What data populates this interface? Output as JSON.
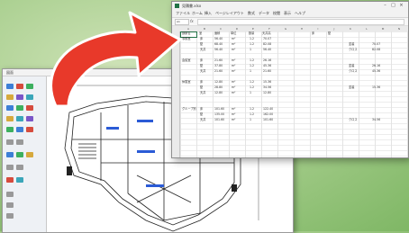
{
  "cad": {
    "title": "図面",
    "tool_colors": [
      "#3d7fd6",
      "#d64b3d",
      "#3db05f",
      "#d6a93d",
      "#7a56c8",
      "#3aa6b9"
    ]
  },
  "excel": {
    "document_title": "見積書.xlsx",
    "menu": [
      "ファイル",
      "ホーム",
      "挿入",
      "ページレイアウト",
      "数式",
      "データ",
      "校閲",
      "表示",
      "ヘルプ"
    ],
    "name_box": "A1",
    "fx_label": "fx",
    "columns": [
      "A",
      "B",
      "C",
      "D",
      "E",
      "F",
      "G",
      "H",
      "I",
      "J",
      "K",
      "L",
      "M",
      "N"
    ],
    "header_row": [
      "部屋名",
      "室",
      "面積",
      "単位",
      "数量",
      "天井高",
      "床",
      "壁",
      "天井"
    ],
    "rows": [
      [
        "事務室",
        "床",
        "56.40",
        "m²",
        "1.2",
        "70.07"
      ],
      [
        "",
        "壁",
        "68.40",
        "m²",
        "1.2",
        "82.08"
      ],
      [
        "",
        "天井",
        "56.40",
        "m²",
        "1",
        "56.40"
      ],
      [
        "会議室",
        "床",
        "21.60",
        "m²",
        "1.2",
        "26.16"
      ],
      [
        "",
        "壁",
        "37.80",
        "m²",
        "1.2",
        "45.36"
      ],
      [
        "",
        "天井",
        "21.60",
        "m²",
        "1",
        "21.60"
      ],
      [
        "休憩室",
        "床",
        "12.80",
        "m²",
        "1.2",
        "15.36"
      ],
      [
        "",
        "壁",
        "28.80",
        "m²",
        "1.2",
        "34.56"
      ],
      [
        "",
        "天井",
        "12.80",
        "m²",
        "1",
        "12.80"
      ],
      [
        "グループ別",
        "床",
        "101.60",
        "m²",
        "1.2",
        "122.40"
      ],
      [
        "",
        "壁",
        "135.00",
        "m²",
        "1.2",
        "162.00"
      ],
      [
        "",
        "天井",
        "101.60",
        "m²",
        "1",
        "101.60"
      ]
    ],
    "side_notes": [
      "塗装",
      "70.07",
      "クロス",
      "82.08",
      "塗装",
      "26.16",
      "クロス",
      "45.36",
      "塗装",
      "15.36",
      "クロス",
      "34.56"
    ]
  },
  "colors": {
    "arrow": "#e8392a",
    "excel_green": "#217346"
  }
}
